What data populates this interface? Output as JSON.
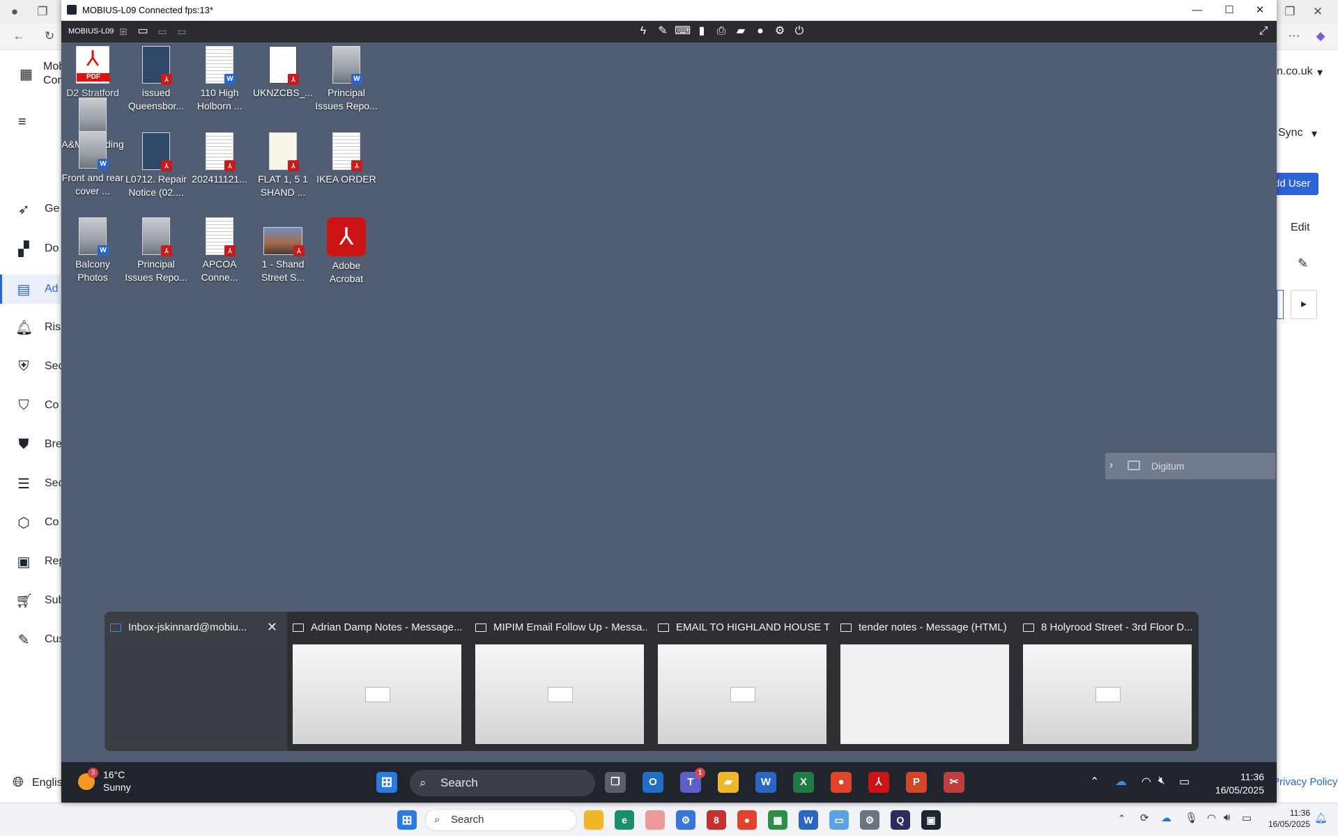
{
  "remote_window": {
    "title": "MOBIUS-L09 Connected fps:13*",
    "host_label": "MOBIUS-L09",
    "desktop_icons": [
      {
        "label": "L0712. Repair Notice (02....",
        "type": "pdf"
      },
      {
        "label": "issued Queensbor...",
        "type": "pdf"
      },
      {
        "label": "110 High Holborn ...",
        "type": "word"
      },
      {
        "label": "UKNZCBS_...",
        "type": "pdf"
      },
      {
        "label": "Principal Issues Repo...",
        "type": "word"
      },
      {
        "label": "D2 Stratford Se...",
        "type": "pdf"
      },
      {
        "label": "A&M Wedding",
        "type": "photo"
      },
      {
        "label": "Front and rear cover ...",
        "type": "word"
      },
      {
        "label": "L0712. Repair Notice (02....",
        "type": "pdf"
      },
      {
        "label": "202411121...",
        "type": "pdf"
      },
      {
        "label": "FLAT 1, 5 1 SHAND ...",
        "type": "pdf"
      },
      {
        "label": "IKEA ORDER",
        "type": "pdf"
      },
      {
        "label": "Balcony Photos",
        "type": "word"
      },
      {
        "label": "Principal Issues Repo...",
        "type": "pdf"
      },
      {
        "label": "APCOA Conne...",
        "type": "pdf"
      },
      {
        "label": "1 - Shand Street S...",
        "type": "pdf"
      },
      {
        "label": "Adobe Acrobat",
        "type": "app"
      }
    ],
    "digitum_label": "Digitum",
    "previews": [
      {
        "title": "Inbox-jskinnard@mobiu..."
      },
      {
        "title": "Adrian Damp Notes - Message..."
      },
      {
        "title": "MIPIM Email Follow Up - Messa..."
      },
      {
        "title": "EMAIL TO HIGHLAND HOUSE T..."
      },
      {
        "title": "tender notes - Message (HTML)"
      },
      {
        "title": "8 Holyrood Street - 3rd Floor D..."
      }
    ],
    "taskbar": {
      "weather_badge": "3",
      "weather_temp": "16°C",
      "weather_cond": "Sunny",
      "search": "Search",
      "teams_badge": "1",
      "time": "11:36",
      "date": "16/05/2025"
    },
    "pdf_text": "PDF"
  },
  "host": {
    "header_app": "Mob Con",
    "header_domain": "n.co.uk",
    "sync_label": "Sync",
    "add_user_label": "dd User",
    "edit_label": "Edit",
    "language": "Englis",
    "privacy": "Privacy Policy",
    "sidebar": [
      {
        "label": "Ge"
      },
      {
        "label": "Do"
      },
      {
        "label": "Ad"
      },
      {
        "label": "Ris"
      },
      {
        "label": "Sec"
      },
      {
        "label": "Co"
      },
      {
        "label": "Bre"
      },
      {
        "label": "Sec"
      },
      {
        "label": "Co"
      },
      {
        "label": "Rep"
      },
      {
        "label": "Sub"
      },
      {
        "label": "Cus"
      }
    ],
    "taskbar": {
      "search": "Search",
      "time": "11:36",
      "date": "16/05/2025"
    }
  },
  "colors": {
    "desktop": "#515d73",
    "accent": "#2c63d6",
    "toolbar": "#2a2c32"
  }
}
